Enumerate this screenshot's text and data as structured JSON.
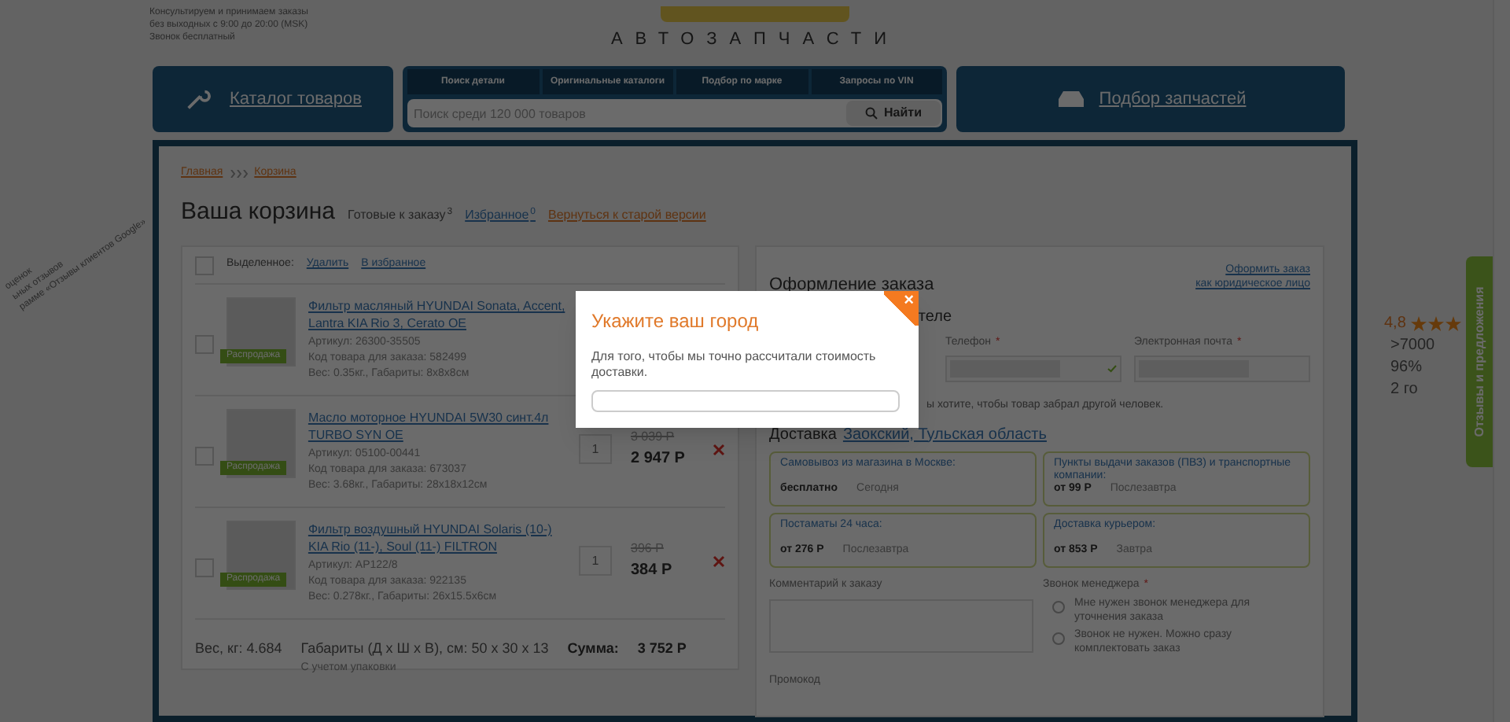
{
  "header": {
    "info_lines": [
      "Консультируем и принимаем заказы",
      "без выходных с 9:00 до 20:00 (MSK)",
      "Звонок бесплатный"
    ],
    "logo_text": "АВТОЗАПЧАСТИ"
  },
  "nav": {
    "catalog_button": "Каталог товаров",
    "tabs": [
      "Поиск детали",
      "Оригинальные каталоги",
      "Подбор по марке",
      "Запросы по VIN"
    ],
    "search": {
      "placeholder": "Поиск среди 120 000 товаров",
      "button": "Найти"
    },
    "parts_button": "Подбор запчастей"
  },
  "breadcrumb": [
    "Главная",
    "Корзина"
  ],
  "title": "Ваша корзина",
  "cart_tabs": [
    {
      "kind": "plain",
      "label": "Готовые к заказу",
      "count": "3"
    },
    {
      "kind": "link",
      "label": "Избранное",
      "count": "0"
    }
  ],
  "old_version_link": "Вернуться к старой версии",
  "cart": {
    "selection_label": "Выделенное:",
    "actions": [
      "Удалить",
      "В избранное"
    ],
    "select_all_checked": false,
    "items": [
      {
        "name": "Фильтр масляный HYUNDAI Sonata, Accent, Lantra KIA Rio 3, Cerato OE",
        "article": "Артикул: 26300-35505",
        "order_code": "Код товара для заказа: 582499",
        "weight": "Вес: 0.35кг., Габариты: 8х8х8см",
        "badge": "Распродажа",
        "checked": false
      },
      {
        "name": "Масло моторное HYUNDAI 5W30 синт.4л TURBO SYN OE",
        "article": "Артикул: 05100-00441",
        "order_code": "Код товара для заказа: 673037",
        "weight": "Вес: 3.68кг., Габариты: 28х18х12см",
        "badge": "Распродажа",
        "checked": false,
        "quantity": "1",
        "old_price": "3 039 Р",
        "price": "2 947 Р"
      },
      {
        "name": "Фильтр воздушный HYUNDAI Solaris (10-) KIA Rio (11-), Soul (11-) FILTRON",
        "article": "Артикул: AP122/8",
        "order_code": "Код товара для заказа: 922135",
        "weight": "Вес: 0.278кг., Габариты: 26х15.5х6см",
        "badge": "Распродажа",
        "checked": false,
        "quantity": "1",
        "old_price": "396 Р",
        "price": "384 Р"
      }
    ],
    "summary": {
      "weight": "Вес, кг: 4.684",
      "dims": "Габариты (Д х Ш х В), см: 50 х 30 х 13",
      "packaging": "С учетом упаковки",
      "sum_label": "Сумма:",
      "sum": "3 752 Р"
    }
  },
  "order": {
    "required_mark": "*",
    "title": "Оформление заказа",
    "legal_link": [
      "Оформить заказ",
      "как юридическое лицо"
    ],
    "section": "теле",
    "fields": [
      {
        "label": "Телефон",
        "required": true,
        "valid": true
      },
      {
        "label": "Электронная почта",
        "required": true,
        "valid": false
      }
    ],
    "note": "ы хотите, чтобы товар забрал другой человек.",
    "delivery_label": "Доставка",
    "delivery_city": "Заокский, Тульская область",
    "options": [
      {
        "title": "Самовывоз из магазина в Москве:",
        "price": "бесплатно",
        "when": "Сегодня"
      },
      {
        "title": "Пункты выдачи заказов (ПВЗ) и транспортные компании:",
        "price": "от 99 Р",
        "when": "Послезавтра"
      },
      {
        "title": "Постаматы 24 часа:",
        "price": "от 276 Р",
        "when": "Послезавтра"
      },
      {
        "title": "Доставка курьером:",
        "price": "от 853 Р",
        "when": "Завтра"
      }
    ],
    "comment_label": "Комментарий к заказу",
    "call_label": "Звонок менеджера",
    "call_required": true,
    "call_options": [
      {
        "label": "Мне нужен звонок менеджера для уточнения заказа",
        "selected": false
      },
      {
        "label": "Звонок не нужен. Можно сразу комплектовать заказ",
        "selected": false
      }
    ],
    "promo_label": "Промокод"
  },
  "side": {
    "google_lines": [
      "оценок",
      "ьных отзывов",
      "рамме «Отзывы клиентов Google»"
    ],
    "rating": "4,8",
    "stars": 3,
    "rating_lines": [
      ">7000",
      "96%",
      "2 го"
    ],
    "feedback_tab": "Отзывы и предложения"
  },
  "modal": {
    "title": "Укажите ваш город",
    "text": "Для того, чтобы мы точно рассчитали стоимость доставки.",
    "close": "×"
  }
}
